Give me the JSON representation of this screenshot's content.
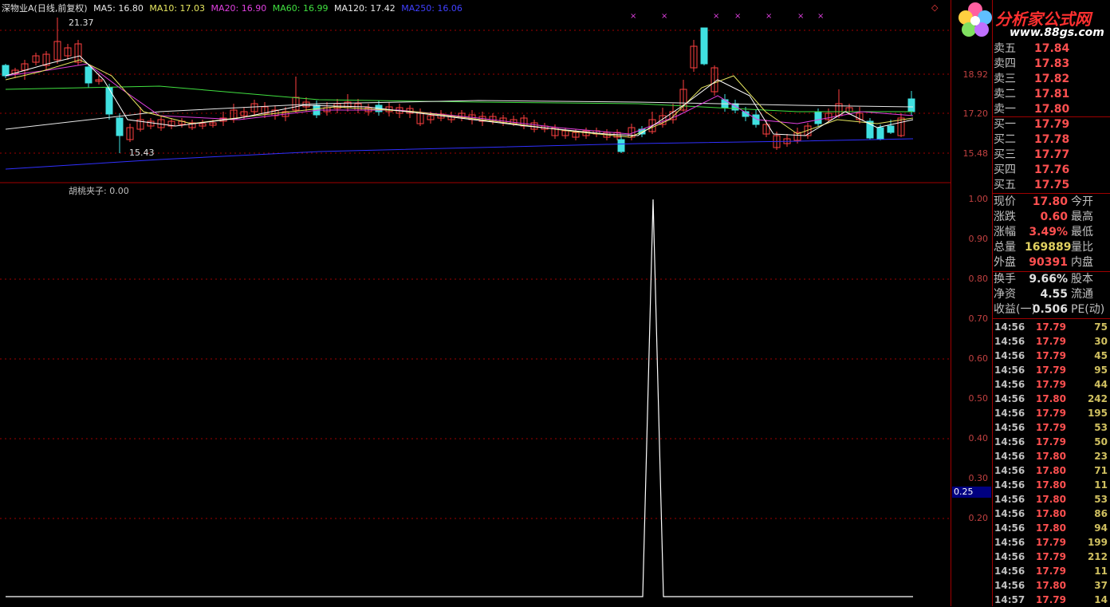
{
  "header": {
    "stock": "深物业A(日线,前复权)",
    "ma": [
      {
        "label": "MA5: 16.80",
        "color": "#e8e8e8"
      },
      {
        "label": "MA10: 17.03",
        "color": "#e8e860"
      },
      {
        "label": "MA20: 16.90",
        "color": "#e040e0"
      },
      {
        "label": "MA60: 16.99",
        "color": "#40e040"
      },
      {
        "label": "MA120: 17.42",
        "color": "#e8e8e8"
      },
      {
        "label": "MA250: 16.06",
        "color": "#3030ff"
      }
    ]
  },
  "price_axis": [
    "18.92",
    "17.20",
    "15.48"
  ],
  "annotations": {
    "high": "21.37",
    "low": "15.43"
  },
  "indicator": {
    "legend": "胡桃夹子: 0.00",
    "axis": [
      "1.00",
      "0.90",
      "0.80",
      "0.70",
      "0.60",
      "0.50",
      "0.40",
      "0.30",
      "0.20"
    ],
    "cursor": "0.25"
  },
  "logo": {
    "brand": "分析家公式网",
    "url": "www.88gs.com"
  },
  "orderbook": {
    "sell": [
      {
        "label": "卖五",
        "price": "17.84"
      },
      {
        "label": "卖四",
        "price": "17.83"
      },
      {
        "label": "卖三",
        "price": "17.82"
      },
      {
        "label": "卖二",
        "price": "17.81"
      },
      {
        "label": "卖一",
        "price": "17.80"
      }
    ],
    "buy": [
      {
        "label": "买一",
        "price": "17.79"
      },
      {
        "label": "买二",
        "price": "17.78"
      },
      {
        "label": "买三",
        "price": "17.77"
      },
      {
        "label": "买四",
        "price": "17.76"
      },
      {
        "label": "买五",
        "price": "17.75"
      }
    ]
  },
  "quote": [
    {
      "label": "现价",
      "value": "17.80",
      "label2": "今开",
      "color": "red"
    },
    {
      "label": "涨跌",
      "value": "0.60",
      "label2": "最高",
      "color": "red"
    },
    {
      "label": "涨幅",
      "value": "3.49%",
      "label2": "最低",
      "color": "red"
    },
    {
      "label": "总量",
      "value": "169889",
      "label2": "量比",
      "color": "yellow"
    },
    {
      "label": "外盘",
      "value": "90391",
      "label2": "内盘",
      "color": "red"
    }
  ],
  "fundamentals": [
    {
      "label": "换手",
      "value": "9.66%",
      "label2": "股本"
    },
    {
      "label": "净资",
      "value": "4.55",
      "label2": "流通"
    },
    {
      "label": "收益(一)",
      "value": "0.506",
      "label2": "PE(动)"
    }
  ],
  "ticks": [
    {
      "time": "14:56",
      "price": "17.79",
      "vol": "75"
    },
    {
      "time": "14:56",
      "price": "17.79",
      "vol": "30"
    },
    {
      "time": "14:56",
      "price": "17.79",
      "vol": "45"
    },
    {
      "time": "14:56",
      "price": "17.79",
      "vol": "95"
    },
    {
      "time": "14:56",
      "price": "17.79",
      "vol": "44"
    },
    {
      "time": "14:56",
      "price": "17.80",
      "vol": "242"
    },
    {
      "time": "14:56",
      "price": "17.79",
      "vol": "195"
    },
    {
      "time": "14:56",
      "price": "17.79",
      "vol": "53"
    },
    {
      "time": "14:56",
      "price": "17.79",
      "vol": "50"
    },
    {
      "time": "14:56",
      "price": "17.80",
      "vol": "23"
    },
    {
      "time": "14:56",
      "price": "17.80",
      "vol": "71"
    },
    {
      "time": "14:56",
      "price": "17.80",
      "vol": "11"
    },
    {
      "time": "14:56",
      "price": "17.80",
      "vol": "53"
    },
    {
      "time": "14:56",
      "price": "17.80",
      "vol": "86"
    },
    {
      "time": "14:56",
      "price": "17.80",
      "vol": "94"
    },
    {
      "time": "14:56",
      "price": "17.79",
      "vol": "199"
    },
    {
      "time": "14:56",
      "price": "17.79",
      "vol": "212"
    },
    {
      "time": "14:56",
      "price": "17.79",
      "vol": "11"
    },
    {
      "time": "14:56",
      "price": "17.80",
      "vol": "37"
    },
    {
      "time": "14:57",
      "price": "17.79",
      "vol": "14"
    }
  ],
  "colors": {
    "up": "#ff4040",
    "down": "#40e0e0",
    "grid": "#a00000"
  }
}
